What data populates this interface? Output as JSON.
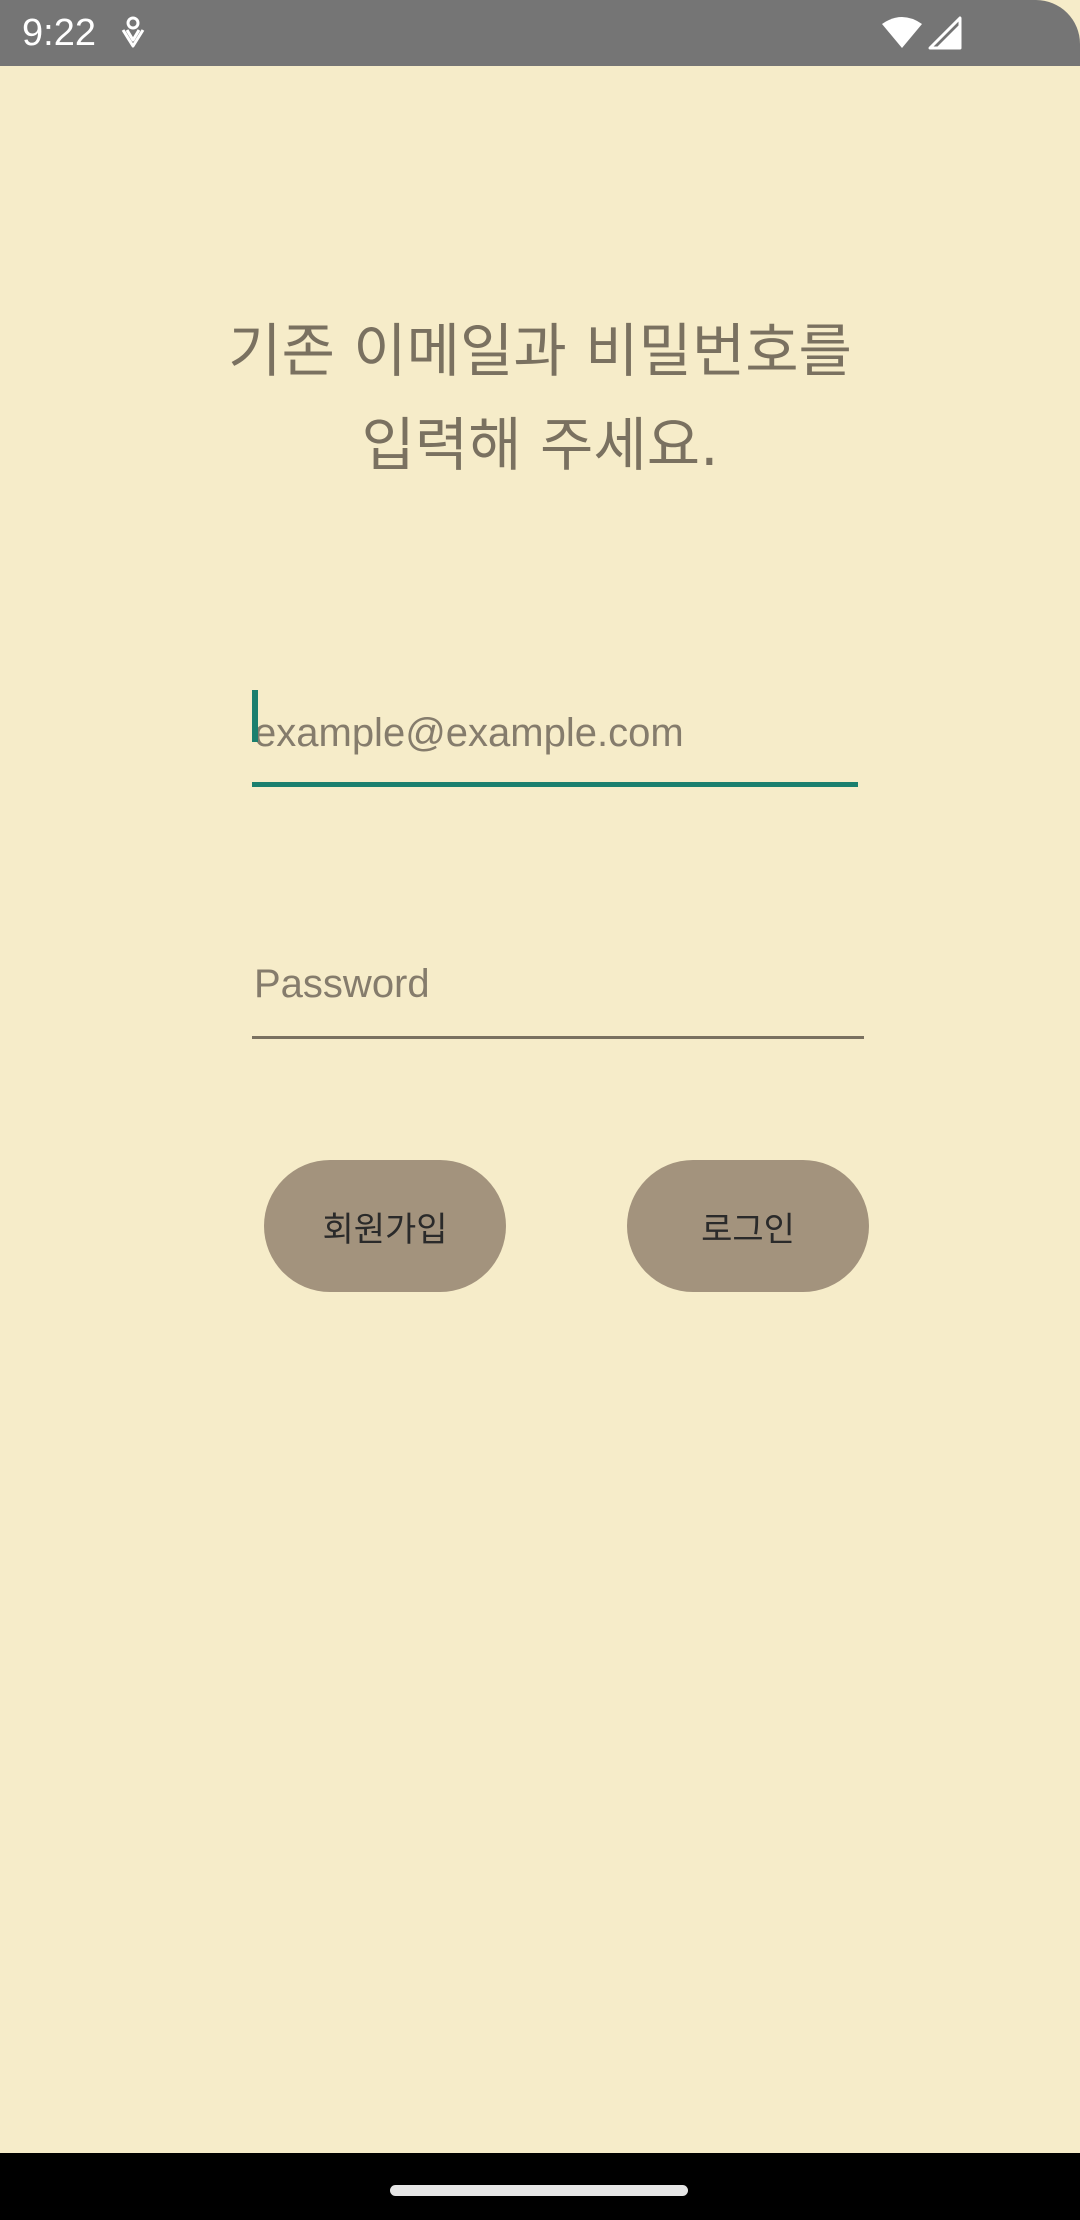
{
  "status_bar": {
    "time": "9:22",
    "icons": [
      "notification-icon",
      "wifi-icon",
      "signal-icon"
    ]
  },
  "heading": {
    "line1": "기존 이메일과 비밀번호를",
    "line2": "입력해 주세요."
  },
  "email": {
    "placeholder": "example@example.com",
    "value": ""
  },
  "password": {
    "placeholder": "Password",
    "value": ""
  },
  "buttons": {
    "signup_label": "회원가입",
    "login_label": "로그인"
  },
  "colors": {
    "background": "#F6ECC9",
    "accent": "#1B7F6E",
    "button": "#A3937D",
    "text": "#7A7160",
    "status_bar": "#757575"
  }
}
